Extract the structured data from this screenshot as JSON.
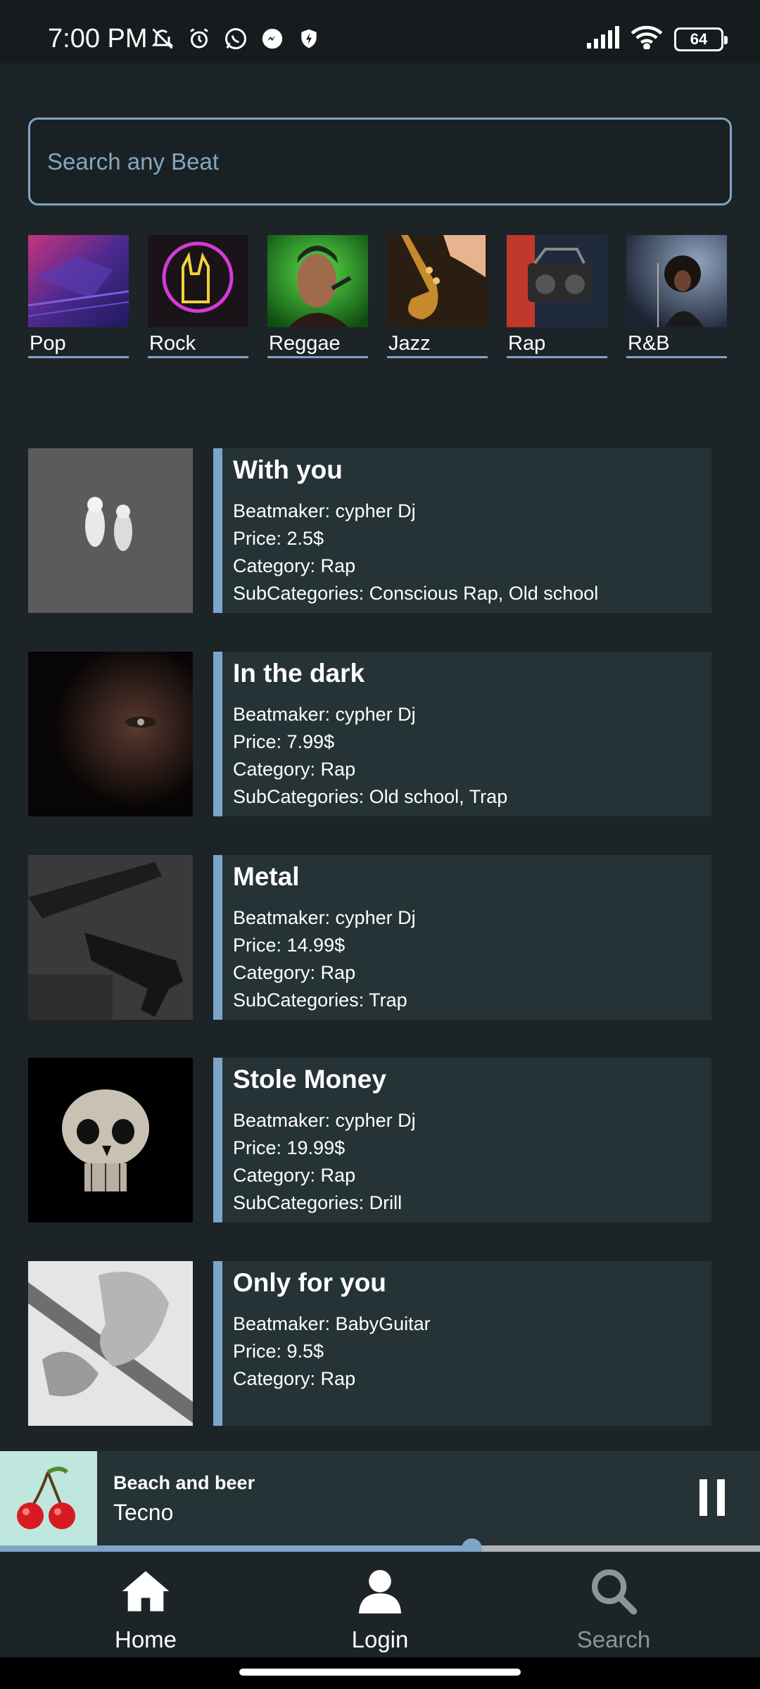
{
  "status_bar": {
    "time": "7:00 PM",
    "battery": "64",
    "icons_left": [
      "mute-icon",
      "alarm-icon",
      "whatsapp-icon",
      "messenger-icon",
      "shield-icon"
    ],
    "icons_right": [
      "signal-icon",
      "wifi-icon",
      "battery-icon"
    ]
  },
  "search": {
    "placeholder": "Search any Beat",
    "value": ""
  },
  "genres": [
    {
      "label": "Pop"
    },
    {
      "label": "Rock"
    },
    {
      "label": "Reggae"
    },
    {
      "label": "Jazz"
    },
    {
      "label": "Rap"
    },
    {
      "label": "R&B"
    }
  ],
  "beats": [
    {
      "title": "With you",
      "beatmaker": "Beatmaker: cypher Dj",
      "price": "Price: 2.5$",
      "category": "Category: Rap",
      "subcategories": "SubCategories: Conscious Rap, Old school"
    },
    {
      "title": "In the dark",
      "beatmaker": "Beatmaker: cypher Dj",
      "price": "Price: 7.99$",
      "category": "Category: Rap",
      "subcategories": "SubCategories: Old school, Trap"
    },
    {
      "title": "Metal",
      "beatmaker": "Beatmaker: cypher Dj",
      "price": "Price: 14.99$",
      "category": "Category: Rap",
      "subcategories": "SubCategories: Trap"
    },
    {
      "title": "Stole Money",
      "beatmaker": "Beatmaker: cypher Dj",
      "price": "Price: 19.99$",
      "category": "Category: Rap",
      "subcategories": "SubCategories: Drill"
    },
    {
      "title": "Only for you",
      "beatmaker": "Beatmaker: BabyGuitar",
      "price": "Price: 9.5$",
      "category": "Category: Rap",
      "subcategories": ""
    }
  ],
  "player": {
    "title": "Beach and beer",
    "subtitle": "Tecno",
    "progress": 0.62
  },
  "nav": {
    "home": "Home",
    "login": "Login",
    "search": "Search"
  },
  "colors": {
    "accent": "#7da5c8",
    "background": "#1d2428",
    "card": "#253236",
    "inactive": "#8e9599"
  }
}
